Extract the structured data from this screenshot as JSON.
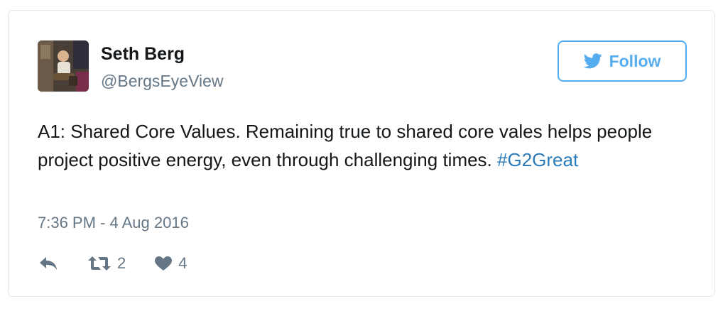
{
  "user": {
    "display_name": "Seth Berg",
    "handle": "@BergsEyeView"
  },
  "follow_button": {
    "label": "Follow",
    "icon": "twitter-bird-icon",
    "color": "#55acee"
  },
  "tweet": {
    "text": "A1: Shared Core Values. Remaining true to shared core vales helps people project positive energy, even through challenging times.",
    "hashtag": "#G2Great",
    "timestamp": "7:36 PM - 4 Aug 2016"
  },
  "actions": {
    "reply": {
      "icon": "reply-icon"
    },
    "retweet": {
      "icon": "retweet-icon",
      "count": "2"
    },
    "like": {
      "icon": "heart-icon",
      "count": "4"
    }
  },
  "colors": {
    "text": "#14171a",
    "secondary": "#657786",
    "link": "#2b7bb9",
    "border": "#e1e8ed"
  }
}
